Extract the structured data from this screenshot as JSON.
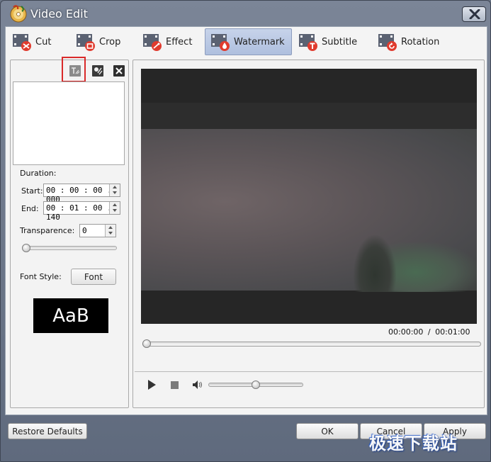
{
  "window": {
    "title": "Video Edit"
  },
  "tabs": [
    {
      "label": "Cut",
      "icon": "scissors-icon",
      "active": false
    },
    {
      "label": "Crop",
      "icon": "crop-icon",
      "active": false
    },
    {
      "label": "Effect",
      "icon": "effect-icon",
      "active": false
    },
    {
      "label": "Watermark",
      "icon": "watermark-drop-icon",
      "active": true
    },
    {
      "label": "Subtitle",
      "icon": "subtitle-t-icon",
      "active": false
    },
    {
      "label": "Rotation",
      "icon": "rotation-icon",
      "active": false
    }
  ],
  "watermark_panel": {
    "toolbar": [
      "add-text-watermark-icon",
      "add-image-watermark-icon",
      "delete-watermark-icon"
    ],
    "duration_label": "Duration:",
    "start_label": "Start:",
    "start_value": "00 : 00 : 00 . 000",
    "end_label": "End:",
    "end_value": "00 : 01 : 00 . 140",
    "transparence_label": "Transparence:",
    "transparence_value": "0",
    "transparence_level": 0,
    "font_style_label": "Font Style:",
    "font_button": "Font",
    "font_preview": "AaB"
  },
  "player": {
    "current_time": "00:00:00",
    "separator": "/",
    "total_time": "00:01:00",
    "seek_progress": 0,
    "volume_level": 0.5
  },
  "footer": {
    "restore_defaults": "Restore Defaults",
    "ok": "OK",
    "cancel": "Cancel",
    "apply": "Apply"
  },
  "site_watermark": "极速下载站",
  "colors": {
    "active_tab": "#b7c6e3",
    "highlight": "#d92a2a",
    "frame": "#6b7587"
  }
}
